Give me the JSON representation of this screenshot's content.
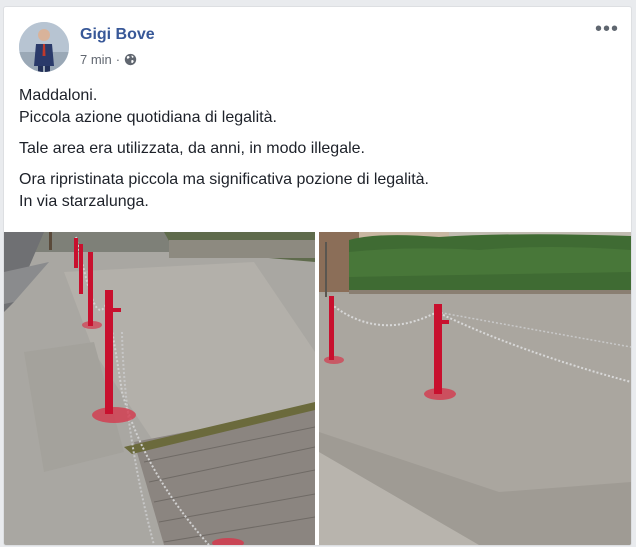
{
  "post": {
    "author": "Gigi Bove",
    "time": "7 min",
    "separator": "·",
    "more_label": "•••",
    "paragraphs": [
      [
        "Maddaloni.",
        "Piccola azione quotidiana di legalità."
      ],
      [
        "Tale area era utilizzata, da anni, in modo illegale."
      ],
      [
        "Ora ripristinata piccola ma significativa pozione di legalità.",
        "In via starzalunga."
      ]
    ]
  },
  "icons": {
    "audience": "globe-icon",
    "menu": "more-options-icon"
  },
  "colors": {
    "author": "#385898",
    "post_text": "#1d2129",
    "meta": "#616770",
    "bollard": "#c8102e"
  }
}
